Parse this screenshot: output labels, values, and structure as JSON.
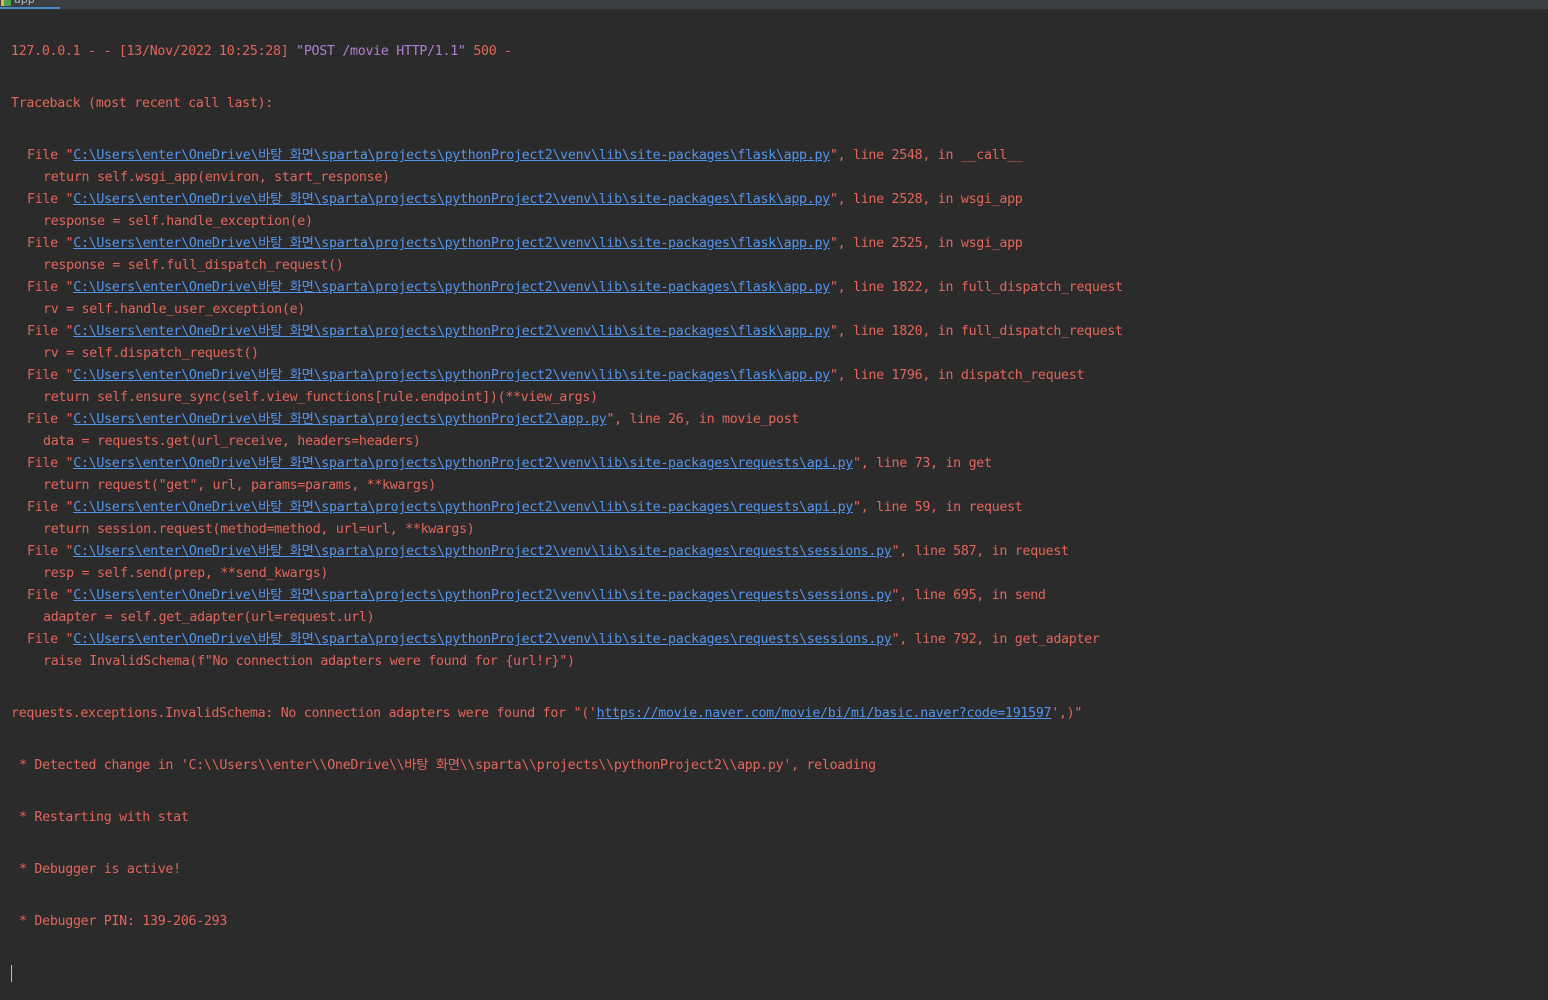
{
  "tab": {
    "label": "app",
    "icon": "python-run-icon"
  },
  "log": {
    "request_prefix": "127.0.0.1 - - [13/Nov/2022 10:25:28] ",
    "request_method_line": "\"POST /movie HTTP/1.1\"",
    "request_suffix": " 500 -",
    "traceback_header": "Traceback (most recent call last):",
    "file_prefix": "File \"",
    "frames": [
      {
        "path": "C:\\Users\\enter\\OneDrive\\바탕 화면\\sparta\\projects\\pythonProject2\\venv\\lib\\site-packages\\flask\\app.py",
        "suffix": "\", line 2548, in __call__",
        "code": "return self.wsgi_app(environ, start_response)"
      },
      {
        "path": "C:\\Users\\enter\\OneDrive\\바탕 화면\\sparta\\projects\\pythonProject2\\venv\\lib\\site-packages\\flask\\app.py",
        "suffix": "\", line 2528, in wsgi_app",
        "code": "response = self.handle_exception(e)"
      },
      {
        "path": "C:\\Users\\enter\\OneDrive\\바탕 화면\\sparta\\projects\\pythonProject2\\venv\\lib\\site-packages\\flask\\app.py",
        "suffix": "\", line 2525, in wsgi_app",
        "code": "response = self.full_dispatch_request()"
      },
      {
        "path": "C:\\Users\\enter\\OneDrive\\바탕 화면\\sparta\\projects\\pythonProject2\\venv\\lib\\site-packages\\flask\\app.py",
        "suffix": "\", line 1822, in full_dispatch_request",
        "code": "rv = self.handle_user_exception(e)"
      },
      {
        "path": "C:\\Users\\enter\\OneDrive\\바탕 화면\\sparta\\projects\\pythonProject2\\venv\\lib\\site-packages\\flask\\app.py",
        "suffix": "\", line 1820, in full_dispatch_request",
        "code": "rv = self.dispatch_request()"
      },
      {
        "path": "C:\\Users\\enter\\OneDrive\\바탕 화면\\sparta\\projects\\pythonProject2\\venv\\lib\\site-packages\\flask\\app.py",
        "suffix": "\", line 1796, in dispatch_request",
        "code": "return self.ensure_sync(self.view_functions[rule.endpoint])(**view_args)"
      },
      {
        "path": "C:\\Users\\enter\\OneDrive\\바탕 화면\\sparta\\projects\\pythonProject2\\app.py",
        "suffix": "\", line 26, in movie_post",
        "code": "data = requests.get(url_receive, headers=headers)"
      },
      {
        "path": "C:\\Users\\enter\\OneDrive\\바탕 화면\\sparta\\projects\\pythonProject2\\venv\\lib\\site-packages\\requests\\api.py",
        "suffix": "\", line 73, in get",
        "code": "return request(\"get\", url, params=params, **kwargs)"
      },
      {
        "path": "C:\\Users\\enter\\OneDrive\\바탕 화면\\sparta\\projects\\pythonProject2\\venv\\lib\\site-packages\\requests\\api.py",
        "suffix": "\", line 59, in request",
        "code": "return session.request(method=method, url=url, **kwargs)"
      },
      {
        "path": "C:\\Users\\enter\\OneDrive\\바탕 화면\\sparta\\projects\\pythonProject2\\venv\\lib\\site-packages\\requests\\sessions.py",
        "suffix": "\", line 587, in request",
        "code": "resp = self.send(prep, **send_kwargs)"
      },
      {
        "path": "C:\\Users\\enter\\OneDrive\\바탕 화면\\sparta\\projects\\pythonProject2\\venv\\lib\\site-packages\\requests\\sessions.py",
        "suffix": "\", line 695, in send",
        "code": "adapter = self.get_adapter(url=request.url)"
      },
      {
        "path": "C:\\Users\\enter\\OneDrive\\바탕 화면\\sparta\\projects\\pythonProject2\\venv\\lib\\site-packages\\requests\\sessions.py",
        "suffix": "\", line 792, in get_adapter",
        "code": "raise InvalidSchema(f\"No connection adapters were found for {url!r}\")"
      }
    ],
    "exception_prefix": "requests.exceptions.InvalidSchema: No connection adapters were found for \"('",
    "exception_url": "https://movie.naver.com/movie/bi/mi/basic.naver?code=191597",
    "exception_suffix": "',)\"",
    "reload_lines": [
      "* Detected change in 'C:\\\\Users\\\\enter\\\\OneDrive\\\\바탕 화면\\\\sparta\\\\projects\\\\pythonProject2\\\\app.py', reloading",
      "* Restarting with stat",
      "* Debugger is active!",
      "* Debugger PIN: 139-206-293"
    ]
  },
  "colors": {
    "background": "#2b2b2b",
    "error_text": "#e3655b",
    "link": "#5394ec",
    "request_method": "#b07fd1"
  }
}
